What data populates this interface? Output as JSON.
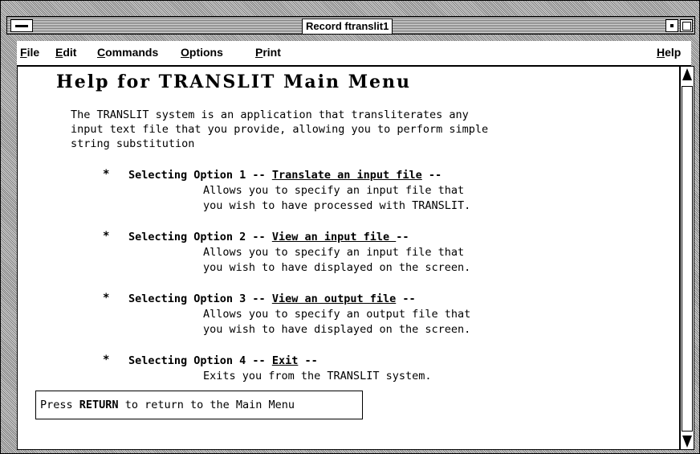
{
  "window": {
    "title": "Record ftranslit1"
  },
  "menubar": {
    "items": [
      {
        "label": "File",
        "mnemonic": "F",
        "rest": "ile"
      },
      {
        "label": "Edit",
        "mnemonic": "E",
        "rest": "dit"
      },
      {
        "label": "Commands",
        "mnemonic": "C",
        "rest": "ommands"
      },
      {
        "label": "Options",
        "mnemonic": "O",
        "rest": "ptions"
      },
      {
        "label": "Print",
        "mnemonic": "P",
        "rest": "rint"
      }
    ],
    "help": {
      "label": "Help",
      "mnemonic": "H",
      "rest": "elp"
    }
  },
  "help": {
    "title": "Help for TRANSLIT Main Menu",
    "intro": [
      "The TRANSLIT system is an application that transliterates any",
      "input text file that you provide, allowing you to perform simple",
      "string substitution"
    ],
    "options": [
      {
        "prefix": "Selecting Option 1 -- ",
        "link": "Translate an input file",
        "suffix": " --",
        "desc": [
          "Allows you to specify an input file that",
          "you wish to have processed with TRANSLIT."
        ]
      },
      {
        "prefix": "Selecting Option 2 -- ",
        "link": "View an input file ",
        "suffix": "--",
        "desc": [
          "Allows you to specify an input file that",
          "you wish to have displayed on the screen."
        ]
      },
      {
        "prefix": "Selecting Option 3 -- ",
        "link": "View an output file",
        "suffix": " --",
        "desc": [
          "Allows you to specify an output file that",
          "you wish to have displayed on the screen."
        ]
      },
      {
        "prefix": "Selecting Option 4 -- ",
        "link": "Exit",
        "suffix": " --",
        "desc": [
          "Exits you from the TRANSLIT system."
        ]
      }
    ],
    "bullet": "*"
  },
  "footer": {
    "press_prefix": "Press ",
    "press_key": "RETURN",
    "press_suffix": " to return to the Main Menu"
  }
}
